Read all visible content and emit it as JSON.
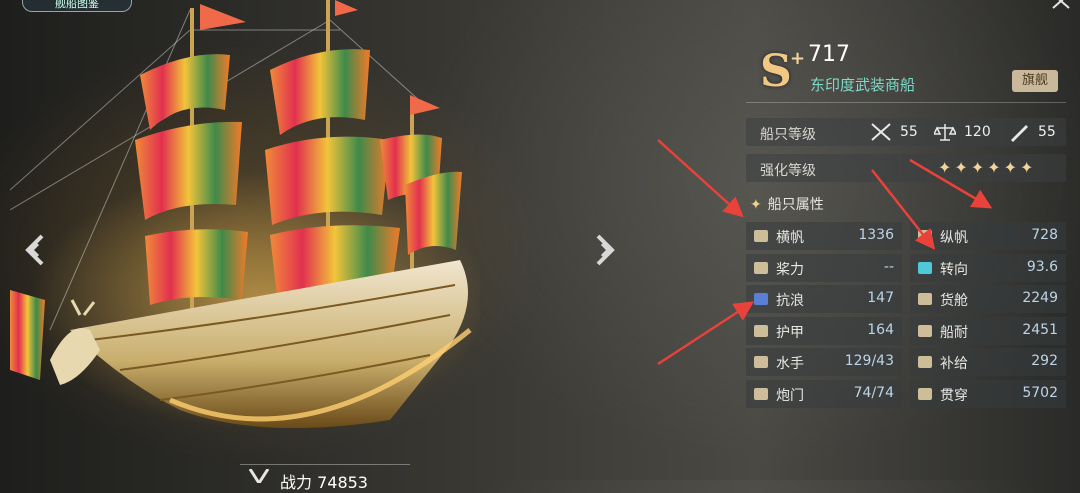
{
  "top_tab": {
    "label": "舰船图鉴"
  },
  "power": {
    "label": "战力 74853"
  },
  "ship": {
    "rank": "S",
    "rank_plus": "+",
    "score": "717",
    "name": "东印度武装商船",
    "flagship_label": "旗舰"
  },
  "ship_level": {
    "label": "船只等级",
    "attack": "55",
    "balance": "120",
    "speed": "55"
  },
  "enhance": {
    "label": "强化等级",
    "stars_count": 6,
    "stars_text": "✦✦✦✦✦✦"
  },
  "attributes": {
    "title": "船只属性",
    "left": [
      {
        "icon": "scroll-icon",
        "name": "横帆",
        "value": "1336"
      },
      {
        "icon": "oar-icon",
        "name": "桨力",
        "value": "--"
      },
      {
        "icon": "wave-icon",
        "name": "抗浪",
        "value": "147"
      },
      {
        "icon": "armor-icon",
        "name": "护甲",
        "value": "164"
      },
      {
        "icon": "sailor-icon",
        "name": "水手",
        "value": "129/43"
      },
      {
        "icon": "cannon-icon",
        "name": "炮门",
        "value": "74/74"
      }
    ],
    "right": [
      {
        "icon": "fore-aft-sail-icon",
        "name": "纵帆",
        "value": "728"
      },
      {
        "icon": "turn-icon",
        "name": "转向",
        "value": "93.6"
      },
      {
        "icon": "barrel-icon",
        "name": "货舱",
        "value": "2249"
      },
      {
        "icon": "hull-icon",
        "name": "船耐",
        "value": "2451"
      },
      {
        "icon": "supply-icon",
        "name": "补给",
        "value": "292"
      },
      {
        "icon": "pierce-icon",
        "name": "贯穿",
        "value": "5702"
      }
    ]
  },
  "colors": {
    "accent_teal": "#7fd9c8",
    "rank_gold": "#f0c884",
    "value_blue": "#bcd4e6",
    "annotation_red": "#e8423a"
  }
}
